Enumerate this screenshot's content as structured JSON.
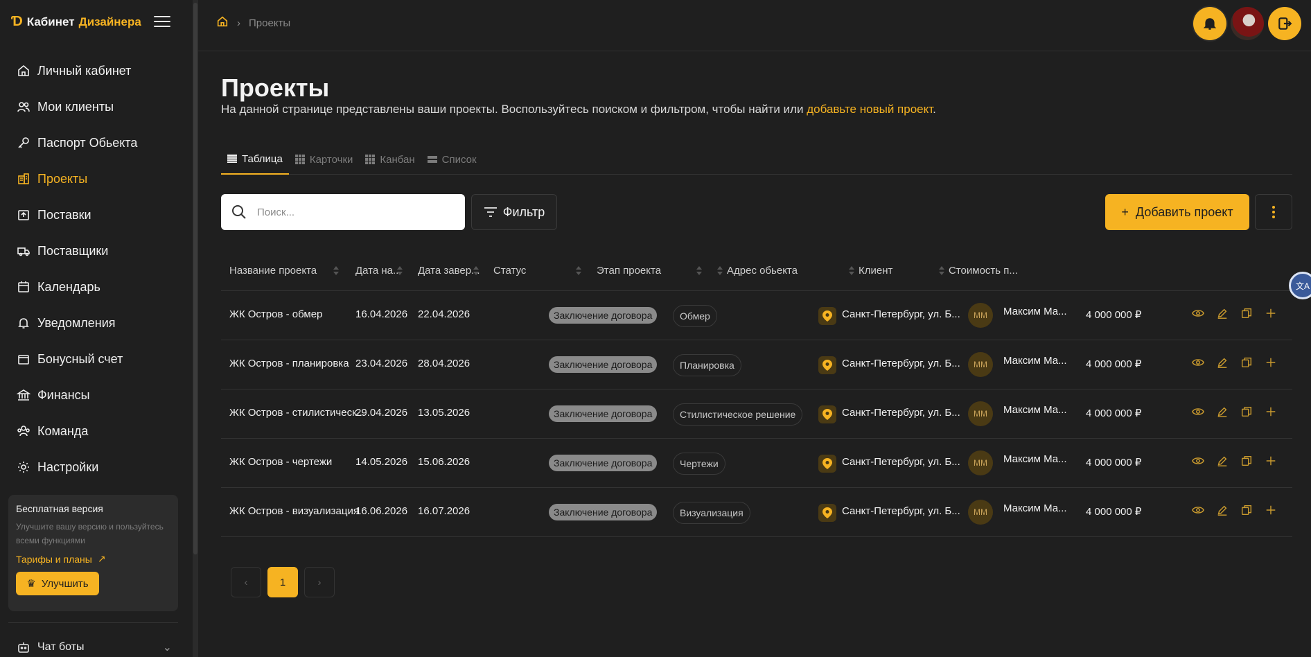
{
  "brand": {
    "word1": "Кабинет",
    "word2": "Дизайнера"
  },
  "sidebar": {
    "items": [
      {
        "label": "Личный кабинет",
        "icon": "home-icon"
      },
      {
        "label": "Мои клиенты",
        "icon": "users-icon"
      },
      {
        "label": "Паспорт Обьекта",
        "icon": "key-icon"
      },
      {
        "label": "Проекты",
        "icon": "building-icon",
        "active": true
      },
      {
        "label": "Поставки",
        "icon": "box-icon"
      },
      {
        "label": "Поставщики",
        "icon": "truck-icon"
      },
      {
        "label": "Календарь",
        "icon": "calendar-icon"
      },
      {
        "label": "Уведомления",
        "icon": "bell-icon"
      },
      {
        "label": "Бонусный счет",
        "icon": "wallet-icon"
      },
      {
        "label": "Финансы",
        "icon": "bank-icon"
      },
      {
        "label": "Команда",
        "icon": "team-icon"
      },
      {
        "label": "Настройки",
        "icon": "gear-icon"
      }
    ],
    "promo": {
      "title": "Бесплатная версия",
      "text": "Улучшите вашу версию и пользуйтесь всеми функциями",
      "link": "Тарифы и планы",
      "button": "Улучшить"
    },
    "chatbots": "Чат боты"
  },
  "breadcrumb": {
    "current": "Проекты"
  },
  "page": {
    "title": "Проекты",
    "description": "На данной странице представлены ваши проекты. Воспользуйтесь поиском и фильтром, чтобы найти или ",
    "description_link": "добавьте новый проект",
    "description_end": "."
  },
  "tabs": [
    {
      "label": "Таблица",
      "active": true
    },
    {
      "label": "Карточки"
    },
    {
      "label": "Канбан"
    },
    {
      "label": "Список"
    }
  ],
  "toolbar": {
    "search_placeholder": "Поиск...",
    "filter_label": "Фильтр",
    "add_label": "Добавить проект"
  },
  "table": {
    "columns": [
      "Название проекта",
      "Дата на...",
      "Дата завер...",
      "Статус",
      "Этап проекта",
      "Адрес обьекта",
      "Клиент",
      "Стоимость п..."
    ],
    "rows": [
      {
        "name": "ЖК Остров - обмер",
        "start": "16.04.2026",
        "end": "22.04.2026",
        "status": "Заключение договора",
        "stage": "Обмер",
        "address": "Санкт-Петербург, ул. Б...",
        "initials": "ММ",
        "client": "Максим Ма...",
        "cost": "4 000 000 ₽"
      },
      {
        "name": "ЖК Остров - планировка",
        "start": "23.04.2026",
        "end": "28.04.2026",
        "status": "Заключение договора",
        "stage": "Планировка",
        "address": "Санкт-Петербург, ул. Б...",
        "initials": "ММ",
        "client": "Максим Ма...",
        "cost": "4 000 000 ₽"
      },
      {
        "name": "ЖК Остров - стилистическ...",
        "start": "29.04.2026",
        "end": "13.05.2026",
        "status": "Заключение договора",
        "stage": "Стилистическое решение",
        "address": "Санкт-Петербург, ул. Б...",
        "initials": "ММ",
        "client": "Максим Ма...",
        "cost": "4 000 000 ₽"
      },
      {
        "name": "ЖК Остров - чертежи",
        "start": "14.05.2026",
        "end": "15.06.2026",
        "status": "Заключение договора",
        "stage": "Чертежи",
        "address": "Санкт-Петербург, ул. Б...",
        "initials": "ММ",
        "client": "Максим Ма...",
        "cost": "4 000 000 ₽"
      },
      {
        "name": "ЖК Остров - визуализация",
        "start": "16.06.2026",
        "end": "16.07.2026",
        "status": "Заключение договора",
        "stage": "Визуализация",
        "address": "Санкт-Петербург, ул. Б...",
        "initials": "ММ",
        "client": "Максим Ма...",
        "cost": "4 000 000 ₽"
      }
    ]
  },
  "pagination": {
    "current": "1"
  },
  "colors": {
    "accent": "#f6b322",
    "background": "#1f1f1f"
  }
}
